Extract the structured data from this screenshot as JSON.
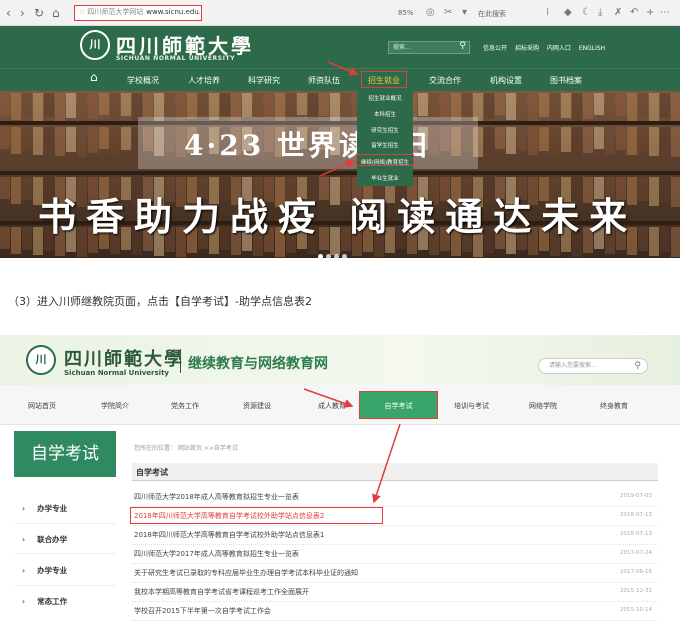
{
  "browser": {
    "url_site": "四川师范大学网站",
    "url": "www.sicnu.edu.cn",
    "zoom": "85%",
    "search_hint": "在此搜索",
    "colors": {
      "highlight": "#e23c3c"
    }
  },
  "site1": {
    "logo_cn": "四川師範大學",
    "logo_en": "SICHUAN NORMAL UNIVERSITY",
    "search_placeholder": "搜索...",
    "top_links": [
      "信息公开",
      "招标采购",
      "内网入口",
      "ENGLISH"
    ],
    "nav": [
      "学校概况",
      "人才培养",
      "科学研究",
      "师资队伍",
      "招生就业",
      "交流合作",
      "机构设置",
      "图书档案"
    ],
    "dropdown": [
      "招生就业概况",
      "本科招生",
      "研究生招生",
      "留学生招生",
      "继续(网络)教育招生",
      "毕业生就业"
    ],
    "banner_title": "4·23 世界读书日",
    "banner_slogan": "书香助力战疫  阅读通达未来",
    "colors": {
      "primary": "#2d6a4a"
    }
  },
  "instruction": "（3）进入川师继教院页面，点击【自学考试】-助学点信息表2",
  "site2": {
    "logo_cn": "四川師範大學",
    "logo_en": "Sichuan Normal University",
    "site_title": "继续教育与网络教育网",
    "search_placeholder": "请输入您要搜索...",
    "nav": [
      "网站首页",
      "学院简介",
      "党务工作",
      "资源建设",
      "成人教育",
      "自学考试",
      "培训与考试",
      "网络学院",
      "终身教育"
    ],
    "active_nav": "自学考试",
    "sidebar_title": "自学考试",
    "sidebar_items": [
      "办学专业",
      "联合办学",
      "办学专业",
      "常态工作"
    ],
    "breadcrumb": "您所在的位置： 网站首页 >>自学考试",
    "section_title": "自学考试",
    "list": [
      {
        "title": "四川师范大学2018年成人高等教育拟招生专业一览表",
        "date": "2019-07-03"
      },
      {
        "title": "2018年四川师范大学高等教育自学考试校外助学站点信息表2",
        "date": "2018-07-13"
      },
      {
        "title": "2018年四川师范大学高等教育自学考试校外助学站点信息表1",
        "date": "2018-07-13"
      },
      {
        "title": "四川师范大学2017年成人高等教育拟招生专业一览表",
        "date": "2017-07-24"
      },
      {
        "title": "关于研究生考试已录取的专科应届毕业生办理自学考试本科毕业证的通知",
        "date": "2017-06-16"
      },
      {
        "title": "我校本学期高等教育自学考试省考课程巡考工作全面展开",
        "date": "2015-12-31"
      },
      {
        "title": "学校召开2015下半年第一次自学考试工作会",
        "date": "2015-10-14"
      }
    ],
    "colors": {
      "primary": "#2f8a62",
      "active": "#3aa56a"
    }
  }
}
